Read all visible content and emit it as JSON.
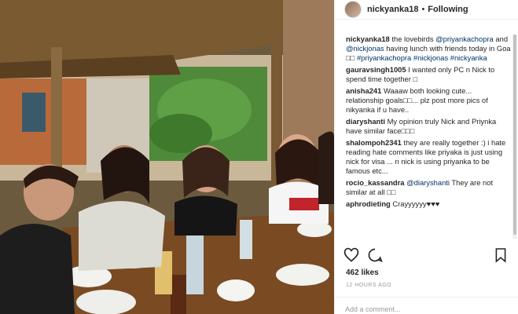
{
  "post": {
    "username": "nickyanka18",
    "separator": "•",
    "follow_label": "Following",
    "caption": {
      "user": "nickyanka18",
      "parts": [
        "the lovebirds ",
        "@priyankachopra",
        " and ",
        "@nickjonas",
        " having lunch with friends today in Goa ",
        "□□",
        " ",
        "#priyankachopra #nickjonas #nickyanka"
      ]
    },
    "comments": [
      {
        "user": "gauravsingh1005",
        "text": "I wanted only PC n Nick to spend time together □"
      },
      {
        "user": "anisha241",
        "text": "Waaaw both looking cute... relationship goals□□... plz post more pics of nikyanka if u have.."
      },
      {
        "user": "diaryshanti",
        "text": "My opinion truly Nick and Priynka have similar face□□□"
      },
      {
        "user": "shalompoh2341",
        "text": "they are really together :) i hate reading hate comments like priyaka is just using nick for visa ... n nick is using priyanka to be famous etc..."
      },
      {
        "user": "rocio_kassandra",
        "mention": "@diaryshanti",
        "text": " They are not similar at all □□"
      },
      {
        "user": "aphrodieting",
        "text": "Crayyyyyy♥♥♥"
      }
    ],
    "likes": "462 likes",
    "timestamp": "12 HOURS AGO",
    "add_comment_placeholder": "Add a comment...",
    "icons": [
      "heart-icon",
      "comment-icon",
      "bookmark-icon"
    ]
  }
}
